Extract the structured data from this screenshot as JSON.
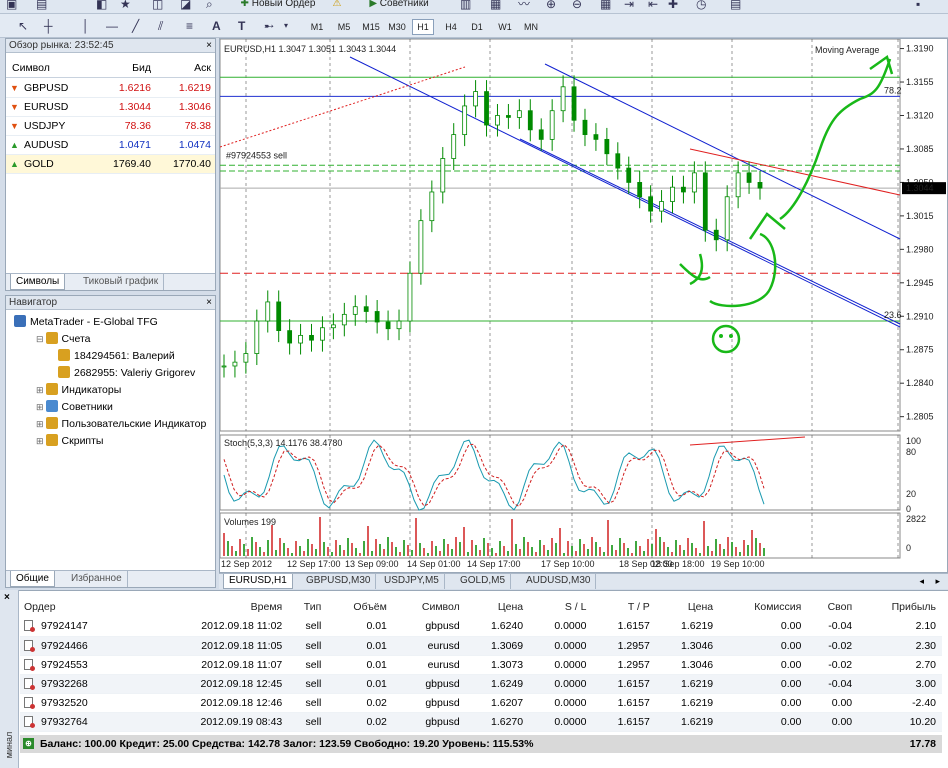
{
  "toolbar": {
    "new_order": "Новый Ордер",
    "experts": "Советники",
    "timeframes": [
      "M1",
      "M5",
      "M15",
      "M30",
      "H1",
      "H4",
      "D1",
      "W1",
      "MN"
    ],
    "active_timeframe": "H1",
    "tool_letters": [
      "A",
      "T"
    ]
  },
  "market_watch": {
    "title": "Обзор рынка: 23:52:45",
    "col_symbol": "Символ",
    "col_bid": "Бид",
    "col_ask": "Аск",
    "rows": [
      {
        "symbol": "GBPUSD",
        "bid": "1.6216",
        "ask": "1.6219",
        "dir": "down",
        "color": "#d01010"
      },
      {
        "symbol": "EURUSD",
        "bid": "1.3044",
        "ask": "1.3046",
        "dir": "down",
        "color": "#d01010"
      },
      {
        "symbol": "USDJPY",
        "bid": "78.36",
        "ask": "78.38",
        "dir": "down",
        "color": "#d01010"
      },
      {
        "symbol": "AUDUSD",
        "bid": "1.0471",
        "ask": "1.0474",
        "dir": "up",
        "color": "#1030c0"
      },
      {
        "symbol": "GOLD",
        "bid": "1769.40",
        "ask": "1770.40",
        "dir": "up",
        "color": "#000000"
      }
    ],
    "tabs": [
      "Символы",
      "Тиковый график"
    ]
  },
  "navigator": {
    "title": "Навигатор",
    "items": [
      {
        "label": "MetaTrader - E-Global TFG",
        "level": 0
      },
      {
        "label": "Счета",
        "level": 1
      },
      {
        "label": "184294561: Валерий",
        "level": 2
      },
      {
        "label": "2682955: Valeriy Grigorev",
        "level": 2
      },
      {
        "label": "Индикаторы",
        "level": 1
      },
      {
        "label": "Советники",
        "level": 1
      },
      {
        "label": "Пользовательские Индикатор",
        "level": 1
      },
      {
        "label": "Скрипты",
        "level": 1
      }
    ],
    "tabs": [
      "Общие",
      "Избранное"
    ]
  },
  "chart": {
    "header": "EURUSD,H1  1.3047 1.3051 1.3043 1.3044",
    "indicator_label": "Moving Average",
    "order_label": "#97924553 sell",
    "current_price": "1.3044",
    "fib_label": "78.2",
    "fib_label2": "23.6",
    "price_ticks": [
      "1.3190",
      "1.3155",
      "1.3120",
      "1.3085",
      "1.3050",
      "1.3015",
      "1.2980",
      "1.2945",
      "1.2910",
      "1.2875",
      "1.2840",
      "1.2805"
    ],
    "time_ticks": [
      "12 Sep 2012",
      "12 Sep 17:00",
      "13 Sep 09:00",
      "14 Sep 01:00",
      "14 Sep 17:00",
      "17 Sep 10:00",
      "18 Sep 02:00",
      "18 Sep 18:00",
      "19 Sep 10:00"
    ],
    "stoch_label": "Stoch(5,3,3) 14.1176 38.4780",
    "stoch_ticks": [
      "100",
      "80",
      "20",
      "0"
    ],
    "volume_label": "Volumes 199",
    "volume_ticks": [
      "2822",
      "0"
    ],
    "tabs": [
      "EURUSD,H1",
      "GBPUSD,M30",
      "USDJPY,M5",
      "GOLD,M5",
      "AUDUSD,M30"
    ],
    "colors": {
      "bull": "#00a000",
      "bear": "#00a000",
      "channel": "#1010d0",
      "red": "#e01010",
      "green_drawing": "#18b818"
    }
  },
  "chart_data": {
    "type": "line",
    "title": "EURUSD,H1",
    "ylabel": "",
    "ylim": [
      1.279,
      1.32
    ],
    "close_series": [
      1.2858,
      1.2862,
      1.2871,
      1.2905,
      1.2925,
      1.2895,
      1.2882,
      1.289,
      1.2885,
      1.2898,
      1.2901,
      1.2912,
      1.292,
      1.2915,
      1.2904,
      1.2897,
      1.2905,
      1.2955,
      1.301,
      1.304,
      1.3075,
      1.31,
      1.313,
      1.3145,
      1.311,
      1.312,
      1.3118,
      1.3125,
      1.3105,
      1.3095,
      1.3125,
      1.315,
      1.3115,
      1.31,
      1.3095,
      1.308,
      1.3065,
      1.305,
      1.3035,
      1.302,
      1.303,
      1.3045,
      1.304,
      1.306,
      1.3,
      1.299,
      1.3035,
      1.306,
      1.305,
      1.3044
    ],
    "current": 1.3044
  },
  "terminal": {
    "columns": [
      "Ордер",
      "Время",
      "Тип",
      "Объём",
      "Символ",
      "Цена",
      "S / L",
      "T / P",
      "Цена",
      "Комиссия",
      "Своп",
      "Прибыль"
    ],
    "rows": [
      [
        "97924147",
        "2012.09.18 11:02",
        "sell",
        "0.01",
        "gbpusd",
        "1.6240",
        "0.0000",
        "1.6157",
        "1.6219",
        "0.00",
        "-0.04",
        "2.10"
      ],
      [
        "97924466",
        "2012.09.18 11:05",
        "sell",
        "0.01",
        "eurusd",
        "1.3069",
        "0.0000",
        "1.2957",
        "1.3046",
        "0.00",
        "-0.02",
        "2.30"
      ],
      [
        "97924553",
        "2012.09.18 11:07",
        "sell",
        "0.01",
        "eurusd",
        "1.3073",
        "0.0000",
        "1.2957",
        "1.3046",
        "0.00",
        "-0.02",
        "2.70"
      ],
      [
        "97932268",
        "2012.09.18 12:45",
        "sell",
        "0.01",
        "gbpusd",
        "1.6249",
        "0.0000",
        "1.6157",
        "1.6219",
        "0.00",
        "-0.04",
        "3.00"
      ],
      [
        "97932520",
        "2012.09.18 12:46",
        "sell",
        "0.02",
        "gbpusd",
        "1.6207",
        "0.0000",
        "1.6157",
        "1.6219",
        "0.00",
        "0.00",
        "-2.40"
      ],
      [
        "97932764",
        "2012.09.19 08:43",
        "sell",
        "0.02",
        "gbpusd",
        "1.6270",
        "0.0000",
        "1.6157",
        "1.6219",
        "0.00",
        "0.00",
        "10.20"
      ]
    ],
    "balance_line": "Баланс: 100.00  Кредит: 25.00  Средства: 142.78  Залог: 123.59  Свободно: 19.20  Уровень: 115.53%",
    "total_profit": "17.78",
    "side_label": "минал"
  }
}
